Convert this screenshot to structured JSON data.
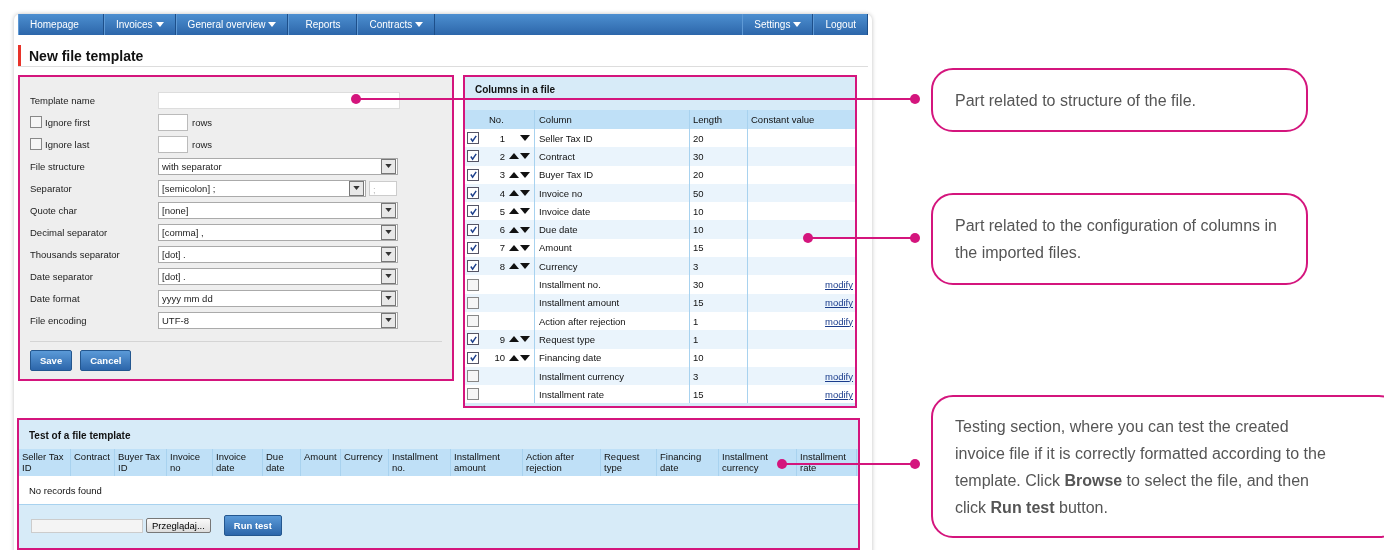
{
  "nav": {
    "left": [
      {
        "label": "Homepage",
        "dropdown": false
      },
      {
        "label": "Invoices",
        "dropdown": true
      },
      {
        "label": "General overview",
        "dropdown": true
      },
      {
        "label": "Reports",
        "dropdown": false
      },
      {
        "label": "Contracts",
        "dropdown": true
      }
    ],
    "right": [
      {
        "label": "Settings",
        "dropdown": true
      },
      {
        "label": "Logout",
        "dropdown": false
      }
    ]
  },
  "page_title": "New file template",
  "form": {
    "fields": [
      {
        "kind": "text",
        "label": "Template name"
      },
      {
        "kind": "rows",
        "label": "Ignore first",
        "checked": false,
        "unit": "rows"
      },
      {
        "kind": "rows",
        "label": "Ignore last",
        "checked": false,
        "unit": "rows"
      },
      {
        "kind": "select",
        "label": "File structure",
        "value": "with separator"
      },
      {
        "kind": "select",
        "label": "Separator",
        "value": "[semicolon] ;",
        "extra_value": ";"
      },
      {
        "kind": "select",
        "label": "Quote char",
        "value": "[none]"
      },
      {
        "kind": "select",
        "label": "Decimal separator",
        "value": "[comma] ,"
      },
      {
        "kind": "select",
        "label": "Thousands separator",
        "value": "[dot] ."
      },
      {
        "kind": "select",
        "label": "Date separator",
        "value": "[dot] ."
      },
      {
        "kind": "select",
        "label": "Date format",
        "value": "yyyy mm dd"
      },
      {
        "kind": "select",
        "label": "File encoding",
        "value": "UTF-8"
      }
    ],
    "buttons": [
      "Save",
      "Cancel"
    ]
  },
  "columns_panel": {
    "title": "Columns in a file",
    "headers": [
      "No.",
      "Column",
      "Length",
      "Constant value"
    ],
    "rows": [
      {
        "checked": true,
        "no": "1",
        "up": false,
        "down": true,
        "column": "Seller Tax ID",
        "length": "20"
      },
      {
        "checked": true,
        "no": "2",
        "up": true,
        "down": true,
        "column": "Contract",
        "length": "30"
      },
      {
        "checked": true,
        "no": "3",
        "up": true,
        "down": true,
        "column": "Buyer Tax ID",
        "length": "20"
      },
      {
        "checked": true,
        "no": "4",
        "up": true,
        "down": true,
        "column": "Invoice no",
        "length": "50"
      },
      {
        "checked": true,
        "no": "5",
        "up": true,
        "down": true,
        "column": "Invoice date",
        "length": "10"
      },
      {
        "checked": true,
        "no": "6",
        "up": true,
        "down": true,
        "column": "Due date",
        "length": "10"
      },
      {
        "checked": true,
        "no": "7",
        "up": true,
        "down": true,
        "column": "Amount",
        "length": "15"
      },
      {
        "checked": true,
        "no": "8",
        "up": true,
        "down": true,
        "column": "Currency",
        "length": "3"
      },
      {
        "checked": false,
        "up": false,
        "down": false,
        "column": "Installment no.",
        "length": "30",
        "action": "modify"
      },
      {
        "checked": false,
        "up": false,
        "down": false,
        "column": "Installment amount",
        "length": "15",
        "action": "modify"
      },
      {
        "checked": false,
        "up": false,
        "down": false,
        "column": "Action after rejection",
        "length": "1",
        "action": "modify"
      },
      {
        "checked": true,
        "no": "9",
        "up": true,
        "down": true,
        "column": "Request type",
        "length": "1"
      },
      {
        "checked": true,
        "no": "10",
        "up": true,
        "down": true,
        "column": "Financing date",
        "length": "10"
      },
      {
        "checked": false,
        "up": false,
        "down": false,
        "column": "Installment currency",
        "length": "3",
        "action": "modify"
      },
      {
        "checked": false,
        "up": false,
        "down": false,
        "column": "Installment rate",
        "length": "15",
        "action": "modify"
      }
    ]
  },
  "test_panel": {
    "title": "Test of a file template",
    "columns": [
      "Seller Tax ID",
      "Contract",
      "Buyer Tax ID",
      "Invoice no",
      "Invoice date",
      "Due date",
      "Amount",
      "Currency",
      "Installment no.",
      "Installment amount",
      "Action after rejection",
      "Request type",
      "Financing date",
      "Installment currency",
      "Installment rate"
    ],
    "empty_message": "No records found",
    "browse_button": "Przeglądaj...",
    "run_button": "Run test"
  },
  "callouts": [
    "Part related to structure of the file.",
    "Part related to the configuration of columns in the imported files.",
    "Testing section, where you can test the created invoice file if it is correctly formatted according to the template. Click **Browse** to select the file, and then click **Run test** button."
  ]
}
